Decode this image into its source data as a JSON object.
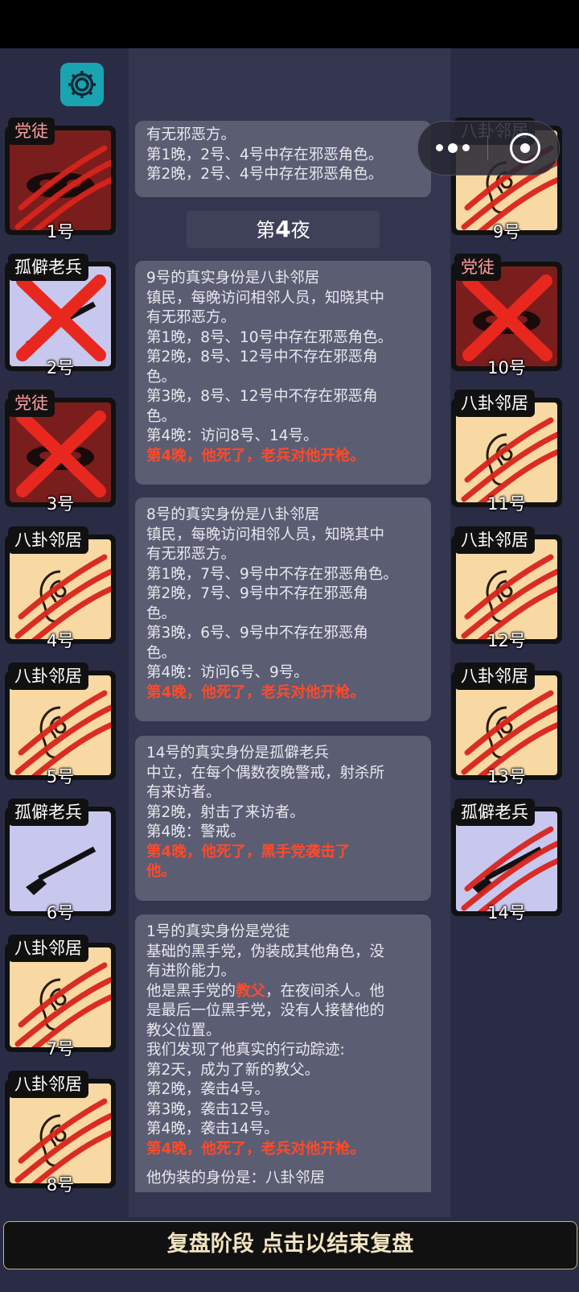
{
  "colors": {
    "bg": "#2a2c46",
    "gear": "#1aa3b0",
    "warn": "#ff4a2a",
    "bagua": "#f8d9a3",
    "dangtu": "#7a1d1d",
    "laobing": "#c8c8ee"
  },
  "cards_left": [
    {
      "role": "党徒",
      "num": "1号",
      "type": "dangtu",
      "mark": "claw",
      "icon": "mask-icon"
    },
    {
      "role": "孤僻老兵",
      "num": "2号",
      "type": "laobing",
      "mark": "cross",
      "icon": "rifle-icon"
    },
    {
      "role": "党徒",
      "num": "3号",
      "type": "dangtu",
      "mark": "cross",
      "icon": "mask-icon"
    },
    {
      "role": "八卦邻居",
      "num": "4号",
      "type": "bagua",
      "mark": "claw",
      "icon": "ear-icon"
    },
    {
      "role": "八卦邻居",
      "num": "5号",
      "type": "bagua",
      "mark": "claw",
      "icon": "ear-icon"
    },
    {
      "role": "孤僻老兵",
      "num": "6号",
      "type": "laobing",
      "mark": "none",
      "icon": "rifle-icon"
    },
    {
      "role": "八卦邻居",
      "num": "7号",
      "type": "bagua",
      "mark": "claw",
      "icon": "ear-icon"
    },
    {
      "role": "八卦邻居",
      "num": "8号",
      "type": "bagua",
      "mark": "claw",
      "icon": "ear-icon"
    }
  ],
  "cards_right": [
    {
      "role": "八卦邻居",
      "num": "9号",
      "type": "bagua",
      "mark": "claw",
      "icon": "ear-icon"
    },
    {
      "role": "党徒",
      "num": "10号",
      "type": "dangtu",
      "mark": "cross",
      "icon": "mask-icon"
    },
    {
      "role": "八卦邻居",
      "num": "11号",
      "type": "bagua",
      "mark": "claw",
      "icon": "ear-icon"
    },
    {
      "role": "八卦邻居",
      "num": "12号",
      "type": "bagua",
      "mark": "claw",
      "icon": "ear-icon"
    },
    {
      "role": "八卦邻居",
      "num": "13号",
      "type": "bagua",
      "mark": "claw",
      "icon": "ear-icon"
    },
    {
      "role": "孤僻老兵",
      "num": "14号",
      "type": "laobing",
      "mark": "claw",
      "icon": "rifle-icon"
    }
  ],
  "msg0": {
    "l1": "有无邪恶方。",
    "l2": "第1晚，2号、4号中存在邪恶角色。",
    "l3": "第2晚，2号、4号中存在邪恶角色。"
  },
  "night": {
    "prefix": "第",
    "num": "4",
    "suffix": "夜"
  },
  "msg1": {
    "l1": "9号的真实身份是八卦邻居",
    "l2": "镇民，每晚访问相邻人员，知晓其中",
    "l3": "有无邪恶方。",
    "l4": "第1晚，8号、10号中存在邪恶角色。",
    "l5": "第2晚，8号、12号中不存在邪恶角",
    "l6": "色。",
    "l7": "第3晚，8号、12号中不存在邪恶角",
    "l8": "色。",
    "l9": "第4晚：访问8号、14号。",
    "red": "第4晚，他死了，老兵对他开枪。"
  },
  "msg2": {
    "l1": "8号的真实身份是八卦邻居",
    "l2": "镇民，每晚访问相邻人员，知晓其中",
    "l3": "有无邪恶方。",
    "l4": "第1晚，7号、9号中不存在邪恶角色。",
    "l5": "第2晚，7号、9号中不存在邪恶角",
    "l6": "色。",
    "l7": "第3晚，6号、9号中不存在邪恶角",
    "l8": "色。",
    "l9": "第4晚：访问6号、9号。",
    "red": "第4晚，他死了，老兵对他开枪。"
  },
  "msg3": {
    "l1": "14号的真实身份是孤僻老兵",
    "l2": "中立，在每个偶数夜晚警戒，射杀所",
    "l3": "有来访者。",
    "l4": "第2晚，射击了来访者。",
    "l5": "第4晚：警戒。",
    "red1": "第4晚，他死了，黑手党袭击了",
    "red2": "他。"
  },
  "msg4": {
    "l1": "1号的真实身份是党徒",
    "l2": "基础的黑手党，伪装成其他角色，没",
    "l3": "有进阶能力。",
    "l4a": "他是黑手党的",
    "l4b": "教父",
    "l4c": "，在夜间杀人。他",
    "l5": "是最后一位黑手党，没有人接替他的",
    "l6": "教父位置。",
    "l7": "我们发现了他真实的行动踪迹:",
    "l8": "第2天，成为了新的教父。",
    "l9": "第2晚，袭击4号。",
    "l10": "第3晚，袭击12号。",
    "l11": "第4晚，袭击14号。",
    "red": "第4晚，他死了，老兵对他开枪。",
    "cut": "他伪装的身份是：八卦邻居"
  },
  "bottom_label": "复盘阶段 点击以结束复盘"
}
